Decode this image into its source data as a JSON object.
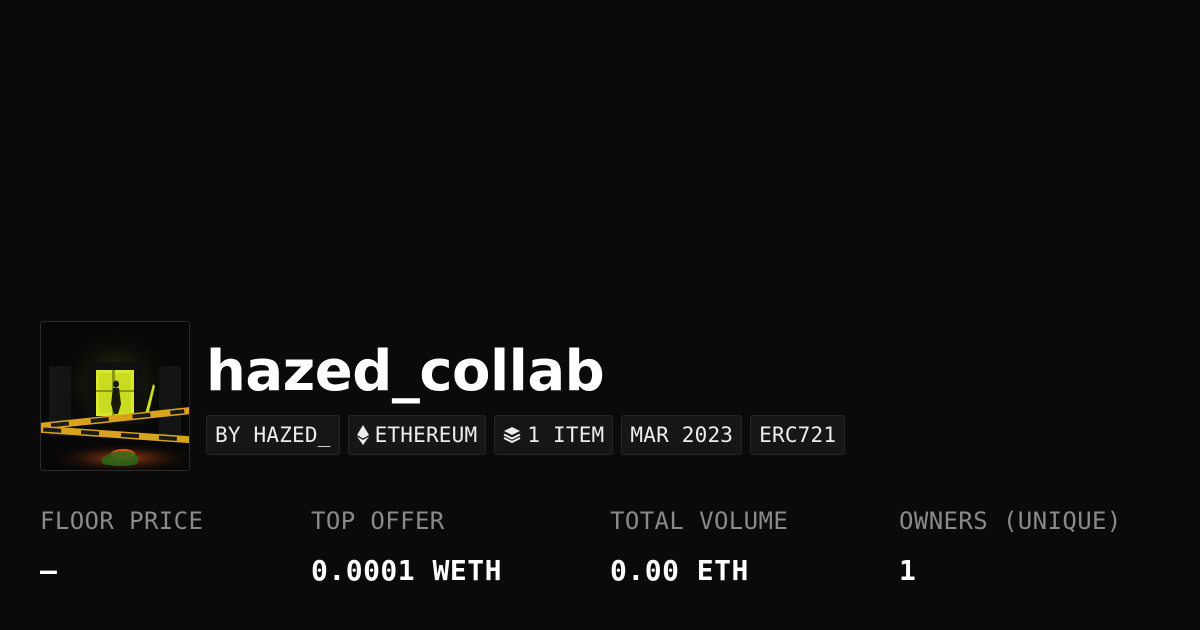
{
  "collection": {
    "name": "hazed_collab",
    "image_alt": "collection-artwork",
    "chips": {
      "creator": "BY HAZED_",
      "chain": "ETHEREUM",
      "items": "1 ITEM",
      "date": "MAR 2023",
      "standard": "ERC721"
    }
  },
  "stats": {
    "floor_price": {
      "label": "FLOOR PRICE",
      "value": "–"
    },
    "top_offer": {
      "label": "TOP OFFER",
      "value": "0.0001 WETH"
    },
    "total_volume": {
      "label": "TOTAL VOLUME",
      "value": "0.00 ETH"
    },
    "owners": {
      "label": "OWNERS (UNIQUE)",
      "value": "1"
    }
  },
  "icons": {
    "chain_icon": "ethereum-icon",
    "items_icon": "layers-icon"
  },
  "colors": {
    "background": "#0a0a0a",
    "text_primary": "#ffffff",
    "text_muted": "#8a8a8a",
    "chip_bg": "#161616",
    "chip_border": "#262626",
    "artwork_glow": "#d8e82a",
    "artwork_tape": "#d9a21c"
  }
}
